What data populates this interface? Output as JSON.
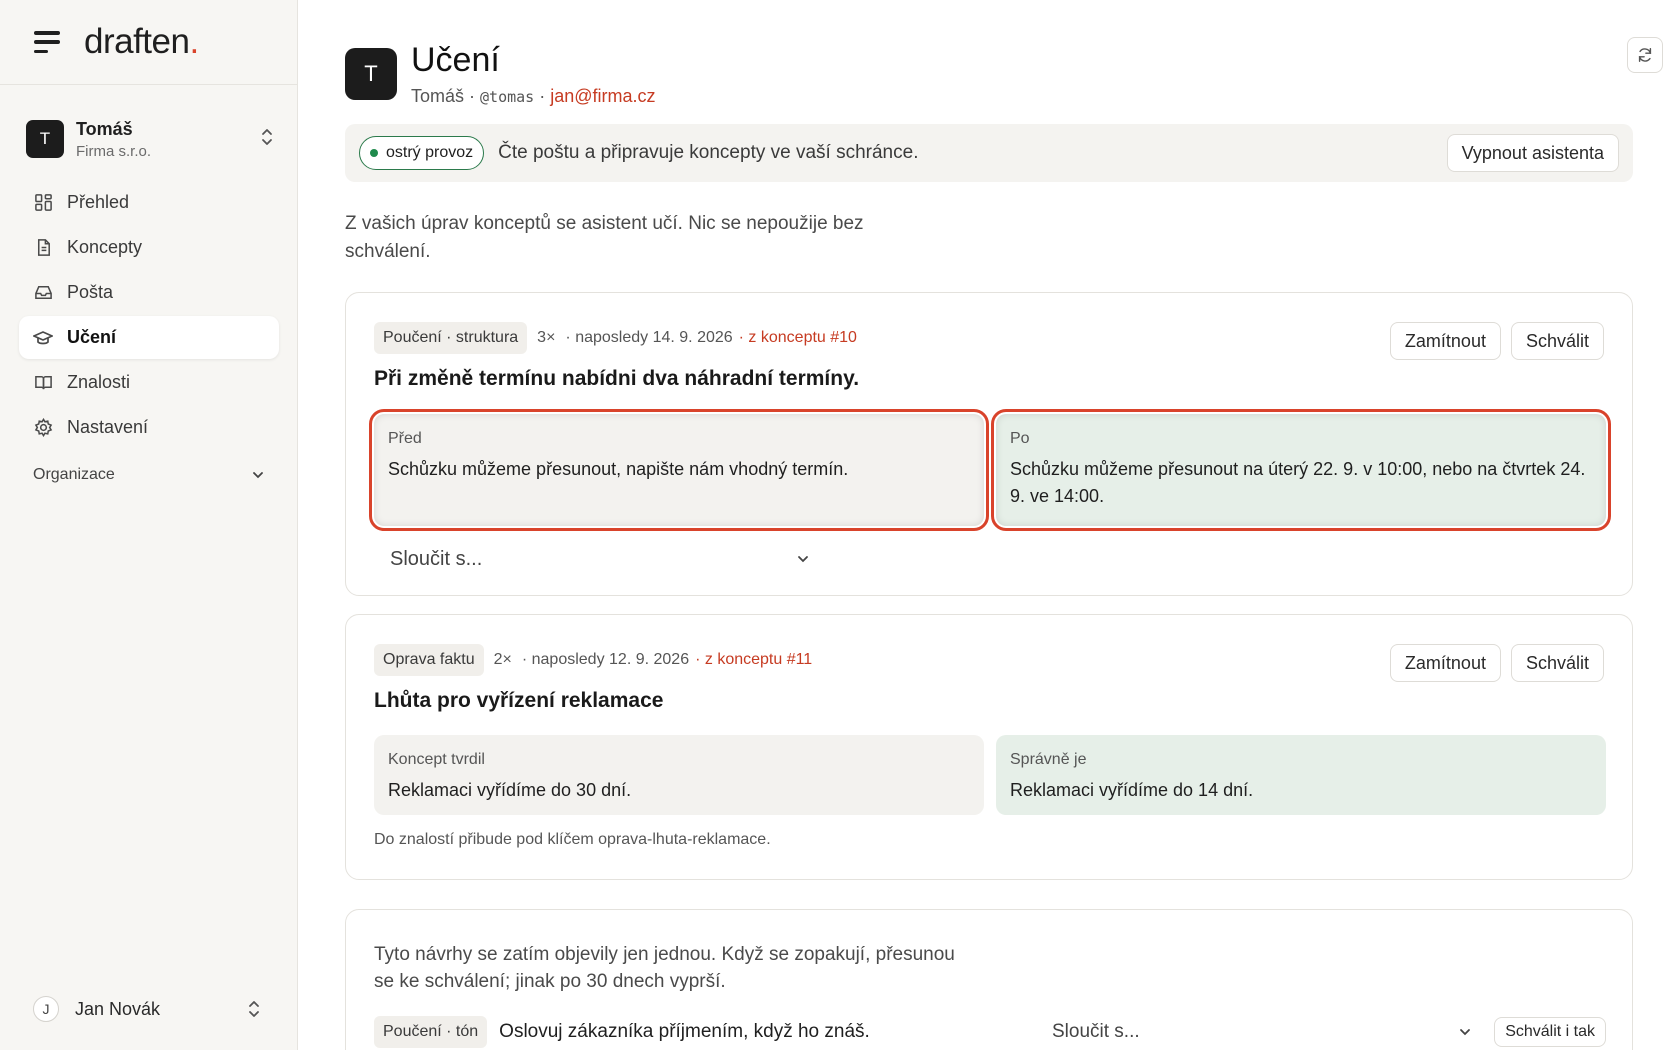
{
  "brand": {
    "logo_text": "draften",
    "logo_dot": "."
  },
  "account": {
    "initial": "T",
    "name": "Tomáš",
    "org": "Firma s.r.o."
  },
  "nav": {
    "items": [
      {
        "label": "Přehled",
        "icon": "grid-icon"
      },
      {
        "label": "Koncepty",
        "icon": "document-icon"
      },
      {
        "label": "Pošta",
        "icon": "inbox-icon"
      },
      {
        "label": "Učení",
        "icon": "graduation-cap-icon",
        "active": true
      },
      {
        "label": "Znalosti",
        "icon": "book-icon"
      },
      {
        "label": "Nastavení",
        "icon": "gear-icon"
      }
    ],
    "section_label": "Organizace"
  },
  "user": {
    "initial": "J",
    "name": "Jan Novák"
  },
  "header": {
    "avatar_initial": "T",
    "title": "Učení",
    "name": "Tomáš",
    "sep1": " · ",
    "handle": "@tomas",
    "sep2": " · ",
    "email": "jan@firma.cz"
  },
  "banner": {
    "status_label": "ostrý provoz",
    "text": "Čte poštu a připravuje koncepty ve vaší schránce.",
    "button_label": "Vypnout asistenta"
  },
  "intro": "Z vašich úprav konceptů se asistent učí. Nic se nepoužije bez schválení.",
  "cards": [
    {
      "tag": "Poučení · struktura",
      "count": "3×",
      "date": "· naposledy 14. 9. 2026",
      "source": "· z konceptu #10",
      "reject_label": "Zamítnout",
      "approve_label": "Schválit",
      "title": "Při změně termínu nabídni dva náhradní termíny.",
      "left_label": "Před",
      "left_text": "Schůzku můžeme přesunout, napište nám vhodný termín.",
      "right_label": "Po",
      "right_text": "Schůzku můžeme přesunout na úterý 22. 9. v 10:00, nebo na čtvrtek 24. 9. ve 14:00.",
      "merge_placeholder": "Sloučit s..."
    },
    {
      "tag": "Oprava faktu",
      "count": "2×",
      "date": "· naposledy 12. 9. 2026",
      "source": "· z konceptu #11",
      "reject_label": "Zamítnout",
      "approve_label": "Schválit",
      "title": "Lhůta pro vyřízení reklamace",
      "left_label": "Koncept tvrdil",
      "left_text": "Reklamaci vyřídíme do 30 dní.",
      "right_label": "Správně je",
      "right_text": "Reklamaci vyřídíme do 14 dní.",
      "footnote": "Do znalostí přibude pod klíčem oprava-lhuta-reklamace."
    }
  ],
  "pending": {
    "text": "Tyto návrhy se zatím objevily jen jednou. Když se zopakují, přesunou se ke schválení; jinak po 30 dnech vyprší.",
    "tag": "Poučení · tón",
    "item_text": "Oslovuj zákazníka příjmením, když ho znáš.",
    "merge_placeholder": "Sloučit s...",
    "approve_label": "Schválit i tak"
  },
  "colors": {
    "accent": "#d9432b",
    "status_green": "#1f8a4c",
    "sidebar_bg": "#f7f6f3",
    "after_panel_bg": "#e6efe8"
  }
}
